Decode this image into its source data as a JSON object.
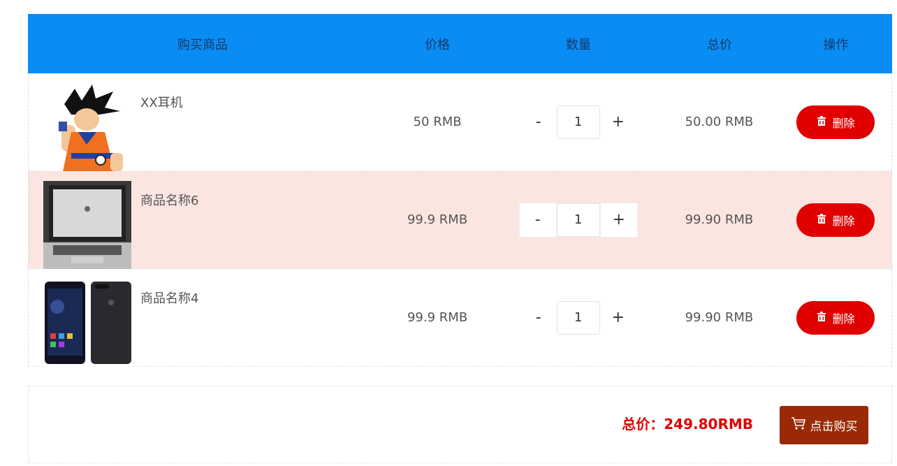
{
  "table": {
    "headers": {
      "product": "购买商品",
      "price": "价格",
      "quantity": "数量",
      "total": "总价",
      "operation": "操作"
    },
    "rows": [
      {
        "name": "XX耳机",
        "price": "50 RMB",
        "quantity": "1",
        "total": "50.00 RMB",
        "delete_label": "删除",
        "image_icon": "anime-character-image"
      },
      {
        "name": "商品名称6",
        "price": "99.9 RMB",
        "quantity": "1",
        "total": "99.90 RMB",
        "delete_label": "删除",
        "image_icon": "laptop-image"
      },
      {
        "name": "商品名称4",
        "price": "99.9 RMB",
        "quantity": "1",
        "total": "99.90 RMB",
        "delete_label": "删除",
        "image_icon": "phone-image"
      }
    ],
    "minus_label": "-",
    "plus_label": "+"
  },
  "footer": {
    "grand_total": "总价：249.80RMB",
    "buy_label": "点击购买"
  },
  "colors": {
    "header_bg": "#0a8cf5",
    "highlight_row": "#fbe5e1",
    "delete_button": "#e00000",
    "buy_button": "#9a2a05",
    "total_text": "#e00000"
  }
}
